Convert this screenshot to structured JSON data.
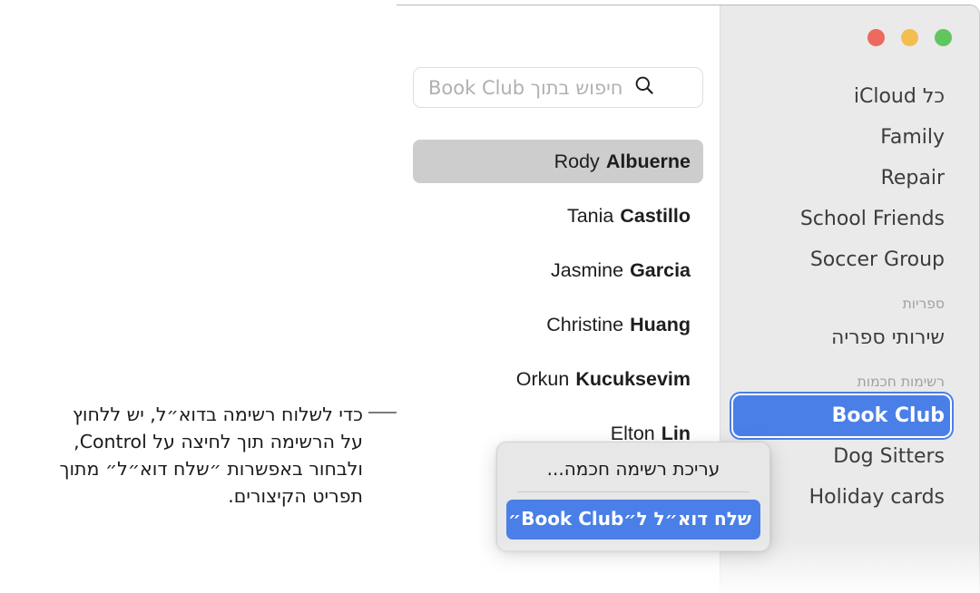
{
  "window": {
    "traffic_lights": [
      {
        "name": "close-button",
        "color": "#5fc75d"
      },
      {
        "name": "minimize-button",
        "color": "#f4bd4f"
      },
      {
        "name": "zoom-button",
        "color": "#ec6a5e"
      }
    ]
  },
  "sidebar": {
    "groups": [
      {
        "header": null,
        "items": [
          {
            "label": "כל iCloud",
            "selected": false
          },
          {
            "label": "Family",
            "selected": false
          },
          {
            "label": "Repair",
            "selected": false
          },
          {
            "label": "School Friends",
            "selected": false
          },
          {
            "label": "Soccer Group",
            "selected": false
          }
        ]
      },
      {
        "header": "ספריות",
        "items": [
          {
            "label": "שירותי ספריה",
            "selected": false
          }
        ]
      },
      {
        "header": "רשימות חכמות",
        "items": [
          {
            "label": "Book Club",
            "selected": true
          },
          {
            "label": "Dog Sitters",
            "selected": false
          },
          {
            "label": "Holiday cards",
            "selected": false
          }
        ]
      }
    ]
  },
  "search": {
    "placeholder": "חיפוש בתוך Book Club",
    "value": "",
    "icon": "search-icon"
  },
  "contacts": [
    {
      "first": "Rody",
      "last": "Albuerne",
      "selected": true
    },
    {
      "first": "Tania",
      "last": "Castillo",
      "selected": false
    },
    {
      "first": "Jasmine",
      "last": "Garcia",
      "selected": false
    },
    {
      "first": "Christine",
      "last": "Huang",
      "selected": false
    },
    {
      "first": "Orkun",
      "last": "Kucuksevim",
      "selected": false
    },
    {
      "first": "Elton",
      "last": "Lin",
      "selected": false
    }
  ],
  "context_menu": {
    "items": [
      {
        "label": "עריכת רשימה חכמה...",
        "highlighted": false
      },
      {
        "label": "שלח דוא״ל ל״Book Club״",
        "highlighted": true
      }
    ]
  },
  "annotation": {
    "lines": [
      "כדי לשלוח רשימה בדוא״ל, יש ללחוץ",
      "על הרשימה תוך לחיצה על Control,",
      "ולבחור באפשרות ״שלח דוא״ל״ מתוך",
      "תפריט הקיצורים."
    ]
  },
  "colors": {
    "accent": "#4a7fe8",
    "sidebar_bg": "#eaeaea",
    "row_selected_bg": "#cdcdcd",
    "callout_line": "#7b7b7b"
  }
}
